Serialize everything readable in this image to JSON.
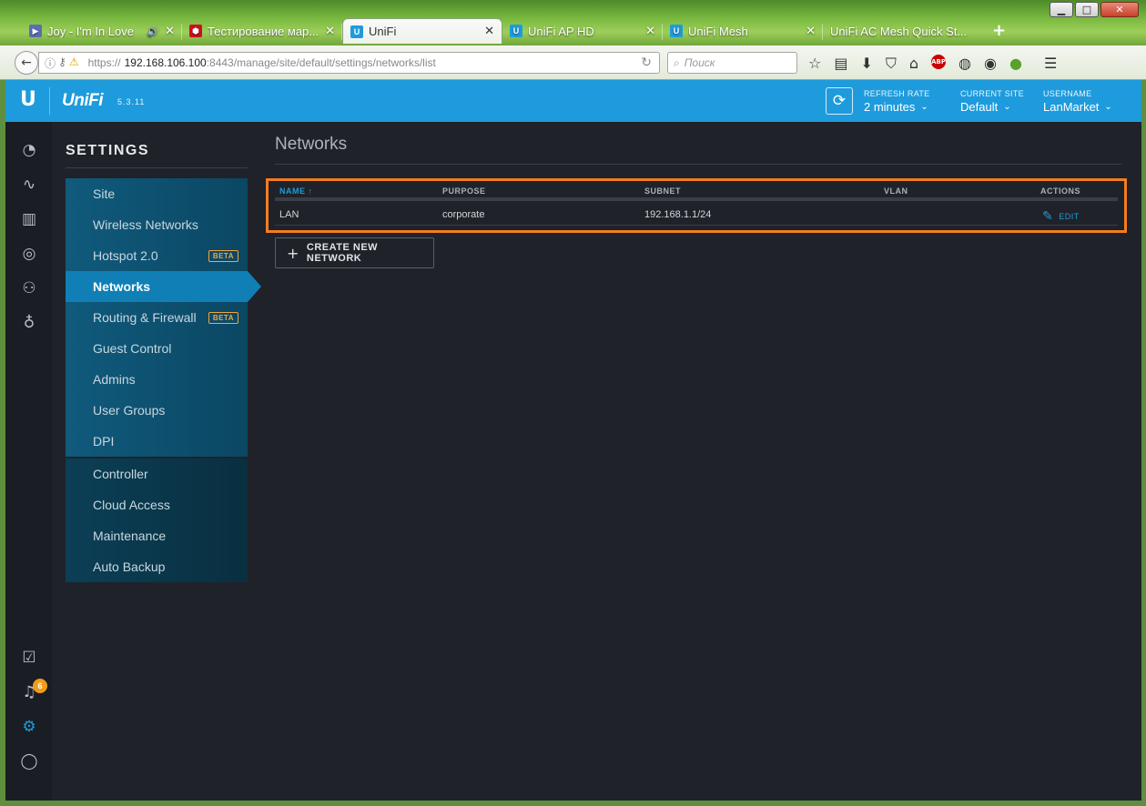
{
  "browser": {
    "window_controls": {
      "minimize": "▁",
      "maximize": "□",
      "close": "✕"
    },
    "tabs": [
      {
        "title": "Joy - I'm In Love",
        "favicon_color": "#5a6fb0",
        "favicon": "▶",
        "audio": true
      },
      {
        "title": "Тестирование мар...",
        "favicon_color": "#cc1122",
        "favicon": "⬢"
      },
      {
        "title": "UniFi",
        "favicon_color": "#1e9bdc",
        "favicon": "U",
        "active": true
      },
      {
        "title": "UniFi AP HD",
        "favicon_color": "#1e9bdc",
        "favicon": "U"
      },
      {
        "title": "UniFi Mesh",
        "favicon_color": "#1e9bdc",
        "favicon": "U"
      },
      {
        "title": "UniFi AC Mesh Quick St...",
        "favicon_color": "",
        "favicon": ""
      }
    ],
    "tab_close": "✕",
    "new_tab": "+",
    "url": {
      "scheme": "https://",
      "host": "192.168.106.100",
      "rest": ":8443/manage/site/default/settings/networks/list"
    },
    "search_placeholder": "Поиск",
    "toolbar_icons": [
      "star-icon",
      "reader-icon",
      "download-icon",
      "pocket-icon",
      "home-icon",
      "adblock-icon",
      "globe-icon",
      "eye-icon",
      "leaf-icon",
      "menu-icon"
    ],
    "adblock_label": "ABP"
  },
  "app": {
    "logo": "U",
    "brand": "UniFi",
    "version": "5.3.11",
    "refresh_rate": {
      "label": "REFRESH RATE",
      "value": "2 minutes"
    },
    "current_site": {
      "label": "CURRENT SITE",
      "value": "Default"
    },
    "username": {
      "label": "USERNAME",
      "value": "LanMarket"
    },
    "notifications_count": "6",
    "settings_title": "SETTINGS",
    "menu_primary": [
      {
        "label": "Site"
      },
      {
        "label": "Wireless Networks"
      },
      {
        "label": "Hotspot 2.0",
        "badge": "BETA"
      },
      {
        "label": "Networks",
        "active": true
      },
      {
        "label": "Routing & Firewall",
        "badge": "BETA"
      },
      {
        "label": "Guest Control"
      },
      {
        "label": "Admins"
      },
      {
        "label": "User Groups"
      },
      {
        "label": "DPI"
      }
    ],
    "menu_secondary": [
      {
        "label": "Controller"
      },
      {
        "label": "Cloud Access"
      },
      {
        "label": "Maintenance"
      },
      {
        "label": "Auto Backup"
      }
    ],
    "page_title": "Networks",
    "table": {
      "headers": {
        "name": "NAME",
        "purpose": "PURPOSE",
        "subnet": "SUBNET",
        "vlan": "VLAN",
        "actions": "ACTIONS"
      },
      "sort_arrow": "↑",
      "rows": [
        {
          "name": "LAN",
          "purpose": "corporate",
          "subnet": "192.168.1.1/24",
          "vlan": "",
          "action": "EDIT"
        }
      ]
    },
    "create_button": "CREATE NEW NETWORK",
    "accent_color": "#1e9bdc",
    "highlight_color": "#f47c20"
  }
}
